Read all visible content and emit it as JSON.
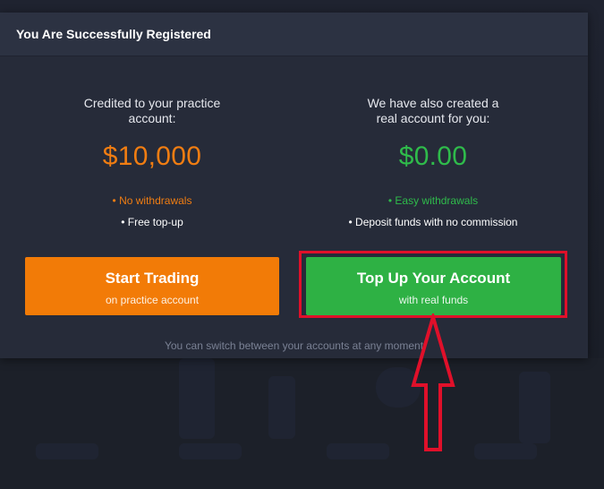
{
  "dialog": {
    "title": "You Are Successfully Registered"
  },
  "practice": {
    "intro_line1": "Credited to your practice",
    "intro_line2": "account:",
    "amount": "$10,000",
    "feature_1": "• No withdrawals",
    "feature_2": "• Free top-up",
    "button_label": "Start Trading",
    "button_sub": "on practice account"
  },
  "real": {
    "intro_line1": "We have also created a",
    "intro_line2": "real account for you:",
    "amount": "$0.00",
    "feature_1": "• Easy withdrawals",
    "feature_2": "• Deposit funds with no commission",
    "button_label": "Top Up Your Account",
    "button_sub": "with real funds"
  },
  "footer_note": "You can switch between your accounts at any moment",
  "colors": {
    "practice_accent": "#f07d12",
    "real_accent": "#2fbb4b",
    "annotation": "#e0102a"
  }
}
